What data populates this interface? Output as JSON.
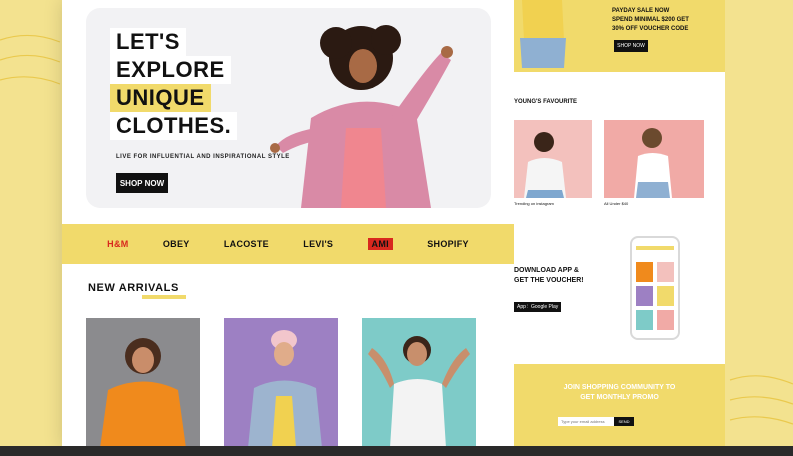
{
  "hero": {
    "title_lines": [
      "LET'S",
      "EXPLORE",
      "UNIQUE",
      "CLOTHES."
    ],
    "subtitle": "LIVE FOR INFLUENTIAL AND INSPIRATIONAL STYLE",
    "cta": "SHOP NOW"
  },
  "brands": [
    "H&M",
    "OBEY",
    "LACOSTE",
    "LEVI'S",
    "AMI",
    "SHOPIFY"
  ],
  "new_arrivals": {
    "title": "NEW ARRIVALS"
  },
  "right_page": {
    "top_lines": [
      "PAYDAY SALE NOW",
      "SPEND MINIMAL $200 GET",
      "30% OFF VOUCHER CODE"
    ],
    "top_button": "SHOP NOW",
    "section_label": "YOUNG'S FAVOURITE",
    "items": [
      "Trending on instagram",
      "All Under $40"
    ],
    "app_text_lines": [
      "DOWNLOAD APP &",
      "GET THE VOUCHER!"
    ],
    "store_badges": [
      "App Store",
      "Google Play"
    ],
    "newsletter_lines": [
      "JOIN SHOPPING COMMUNITY TO",
      "GET MONTHLY PROMO"
    ],
    "newsletter_placeholder": "Type your email address",
    "newsletter_button": "SEND"
  },
  "colors": {
    "accent_yellow": "#f1da6b",
    "background": "#f3e28f",
    "brand_red": "#d8281e"
  }
}
